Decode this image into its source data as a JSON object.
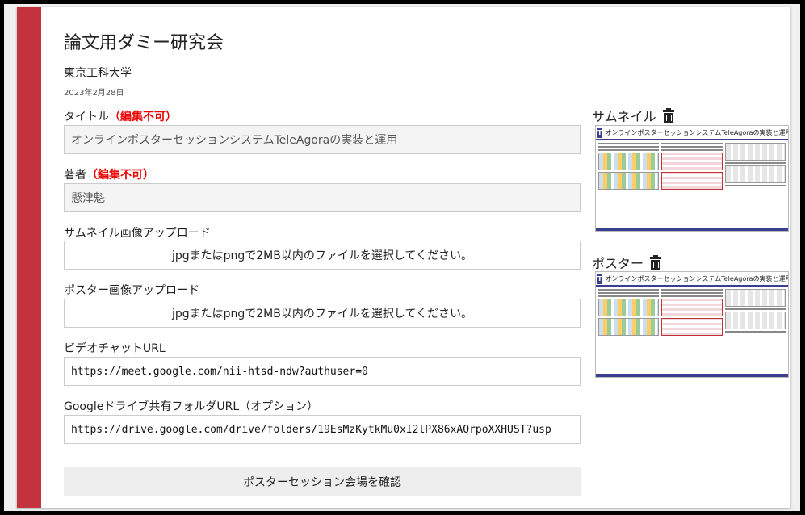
{
  "header": {
    "title": "論文用ダミー研究会",
    "organization": "東京工科大学",
    "date": "2023年2月28日"
  },
  "form": {
    "title_label": "タイトル",
    "title_note": "（編集不可）",
    "title_value": "オンラインポスターセッションシステムTeleAgoraの実装と運用",
    "author_label": "著者",
    "author_note": "（編集不可）",
    "author_value": "懸津魁",
    "thumbnail_upload_label": "サムネイル画像アップロード",
    "thumbnail_upload_text": "jpgまたはpngで2MB以内のファイルを選択してください。",
    "poster_upload_label": "ポスター画像アップロード",
    "poster_upload_text": "jpgまたはpngで2MB以内のファイルを選択してください。",
    "video_label": "ビデオチャットURL",
    "video_value": "https://meet.google.com/nii-htsd-ndw?authuser=0",
    "drive_label": "Googleドライブ共有フォルダURL（オプション）",
    "drive_value": "https://drive.google.com/drive/folders/19EsMzKytkMu0xI2lPX86xAQrpoXXHUST?usp",
    "confirm_button": "ポスターセッション会場を確認"
  },
  "side": {
    "thumbnail_label": "サムネイル",
    "poster_label": "ポスター",
    "poster_title": "オンラインポスターセッションシステムTeleAgoraの実装と運用",
    "trash_icon": "trash-icon"
  },
  "colors": {
    "accent": "#c4323e",
    "note_red": "#ee0000"
  }
}
